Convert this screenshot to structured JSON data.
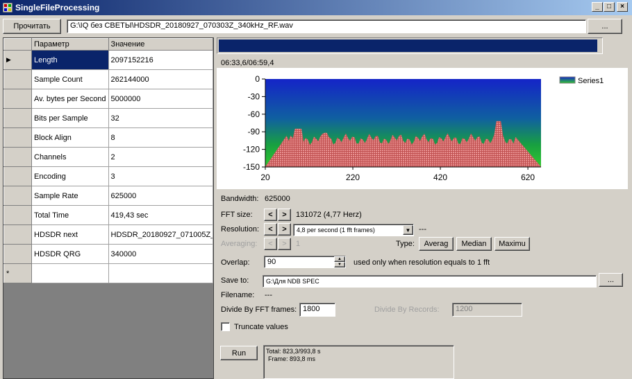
{
  "window": {
    "title": "SingleFileProcessing"
  },
  "toolbar": {
    "read_label": "Прочитать",
    "file_path": "G:\\IQ без СВЕТЫ\\HDSDR_20180927_070303Z_340kHz_RF.wav",
    "browse_label": "..."
  },
  "grid": {
    "columns": [
      "Параметр",
      "Значение"
    ],
    "rows": [
      {
        "name": "Length",
        "value": "2097152216"
      },
      {
        "name": "Sample Count",
        "value": "262144000"
      },
      {
        "name": "Av. bytes per Second",
        "value": "5000000"
      },
      {
        "name": "Bits per Sample",
        "value": "32"
      },
      {
        "name": "Block Align",
        "value": "8"
      },
      {
        "name": "Channels",
        "value": "2"
      },
      {
        "name": "Encoding",
        "value": "3"
      },
      {
        "name": "Sample Rate",
        "value": "625000"
      },
      {
        "name": "Total Time",
        "value": "419,43 sec"
      },
      {
        "name": "HDSDR next",
        "value": "HDSDR_20180927_071005Z_"
      },
      {
        "name": "HDSDR QRG",
        "value": "340000"
      }
    ],
    "new_row_marker": "*",
    "current_row_marker": "▶"
  },
  "progress": {
    "fraction": 0.99,
    "time_text": "06:33,6/06:59,4"
  },
  "chart_data": {
    "type": "area",
    "series": [
      {
        "name": "Series1"
      }
    ],
    "x_ticks": [
      "20",
      "220",
      "420",
      "620"
    ],
    "y_ticks": [
      "0",
      "-30",
      "-60",
      "-90",
      "-120",
      "-150"
    ],
    "xlim": [
      20,
      650
    ],
    "ylim": [
      -150,
      0
    ]
  },
  "settings": {
    "bandwidth_label": "Bandwidth:",
    "bandwidth_value": "625000",
    "fft_label": "FFT size:",
    "fft_value": "131072 (4,77 Herz)",
    "resolution_label": "Resolution:",
    "resolution_value": "4,8 per second (1 fft frames)",
    "resolution_extra": "---",
    "averaging_label": "Averaging:",
    "averaging_value": "1",
    "type_label": "Type:",
    "type_buttons": [
      "Averag",
      "Median",
      "Maximu"
    ],
    "prev_label": "<",
    "next_label": ">",
    "overlap_label": "Overlap:",
    "overlap_value": "90",
    "overlap_note": "used only when resolution equals to 1 fft",
    "save_label": "Save to:",
    "save_value": "G:\\Для NDB SPEC",
    "save_browse": "...",
    "filename_label": "Filename:",
    "filename_value": "---",
    "divide_fft_label": "Divide By FFT frames:",
    "divide_fft_value": "1800",
    "divide_rec_label": "Divide By Records:",
    "divide_rec_value": "1200",
    "truncate_label": "Truncate values",
    "run_label": "Run",
    "log_lines": [
      "Total: 823,3/993,8 s",
      "Frame: 893,8 ms"
    ]
  }
}
